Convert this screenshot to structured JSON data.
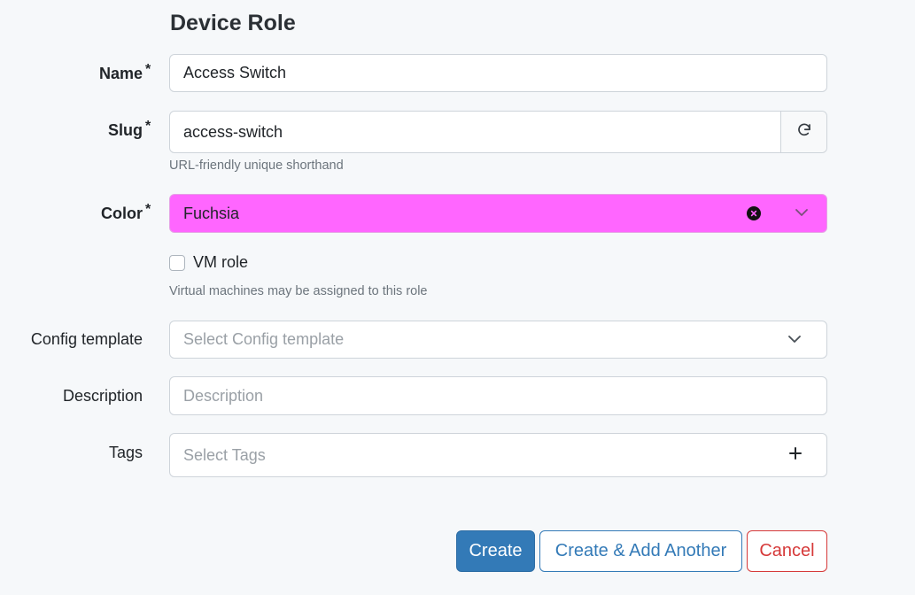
{
  "section": {
    "title": "Device Role"
  },
  "fields": {
    "name": {
      "label": "Name",
      "required": "*",
      "value": "Access Switch"
    },
    "slug": {
      "label": "Slug",
      "required": "*",
      "value": "access-switch",
      "help": "URL-friendly unique shorthand"
    },
    "color": {
      "label": "Color",
      "required": "*",
      "value": "Fuchsia",
      "swatch": "#ff66ff"
    },
    "vm_role": {
      "label": "VM role",
      "help": "Virtual machines may be assigned to this role",
      "checked": false
    },
    "config_template": {
      "label": "Config template",
      "placeholder": "Select Config template"
    },
    "description": {
      "label": "Description",
      "placeholder": "Description"
    },
    "tags": {
      "label": "Tags",
      "placeholder": "Select Tags"
    }
  },
  "buttons": {
    "create": "Create",
    "create_another": "Create & Add Another",
    "cancel": "Cancel"
  },
  "icons": {
    "slug_regenerate": "refresh-icon",
    "color_clear": "clear-icon",
    "dropdown": "chevron-down-icon",
    "tags_add": "plus-icon"
  }
}
